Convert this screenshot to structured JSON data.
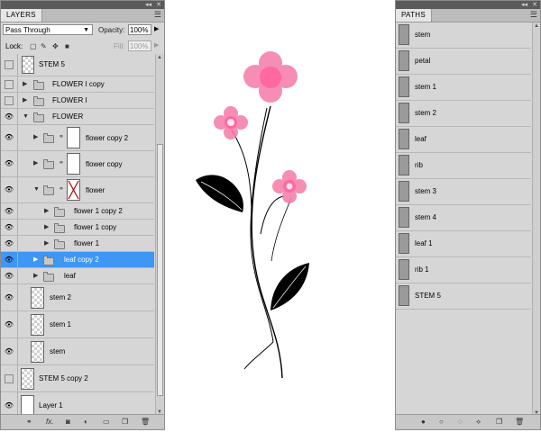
{
  "layers_panel": {
    "tab_title": "LAYERS",
    "blend_mode": "Pass Through",
    "opacity_label": "Opacity:",
    "opacity_value": "100%",
    "lock_label": "Lock:",
    "fill_label": "Fill:",
    "fill_value": "100%",
    "layers": [
      {
        "name": "STEM 5",
        "kind": "layer",
        "visible": false
      },
      {
        "name": "FLOWER I copy",
        "kind": "group",
        "visible": false
      },
      {
        "name": "FLOWER I",
        "kind": "group",
        "visible": false
      },
      {
        "name": "FLOWER",
        "kind": "group",
        "visible": true
      },
      {
        "name": "flower copy 2",
        "kind": "masked-group",
        "visible": true
      },
      {
        "name": "flower copy",
        "kind": "masked-group",
        "visible": true
      },
      {
        "name": "flower",
        "kind": "masked-group",
        "visible": true
      },
      {
        "name": "flower 1 copy 2",
        "kind": "group",
        "visible": true
      },
      {
        "name": "flower 1 copy",
        "kind": "group",
        "visible": true
      },
      {
        "name": "flower 1",
        "kind": "group",
        "visible": true
      },
      {
        "name": "leaf copy 2",
        "kind": "group",
        "visible": true,
        "selected": true
      },
      {
        "name": "leaf",
        "kind": "group",
        "visible": true
      },
      {
        "name": "stem 2",
        "kind": "layer",
        "visible": true
      },
      {
        "name": "stem 1",
        "kind": "layer",
        "visible": true
      },
      {
        "name": "stem",
        "kind": "layer",
        "visible": true
      },
      {
        "name": "STEM 5 copy 2",
        "kind": "layer",
        "visible": false
      },
      {
        "name": "Layer 1",
        "kind": "layer",
        "visible": true
      }
    ]
  },
  "paths_panel": {
    "tab_title": "PATHS",
    "paths": [
      "stem",
      "petal",
      "stem 1",
      "stem 2",
      "leaf",
      "rib",
      "stem 3",
      "stem 4",
      "leaf 1",
      "rib 1",
      "STEM 5"
    ]
  },
  "colors": {
    "selection": "#3e96f5",
    "panel_bg": "#d6d6d6",
    "petal_pink": "#f47aa8",
    "petal_center": "#ff4f8f"
  }
}
